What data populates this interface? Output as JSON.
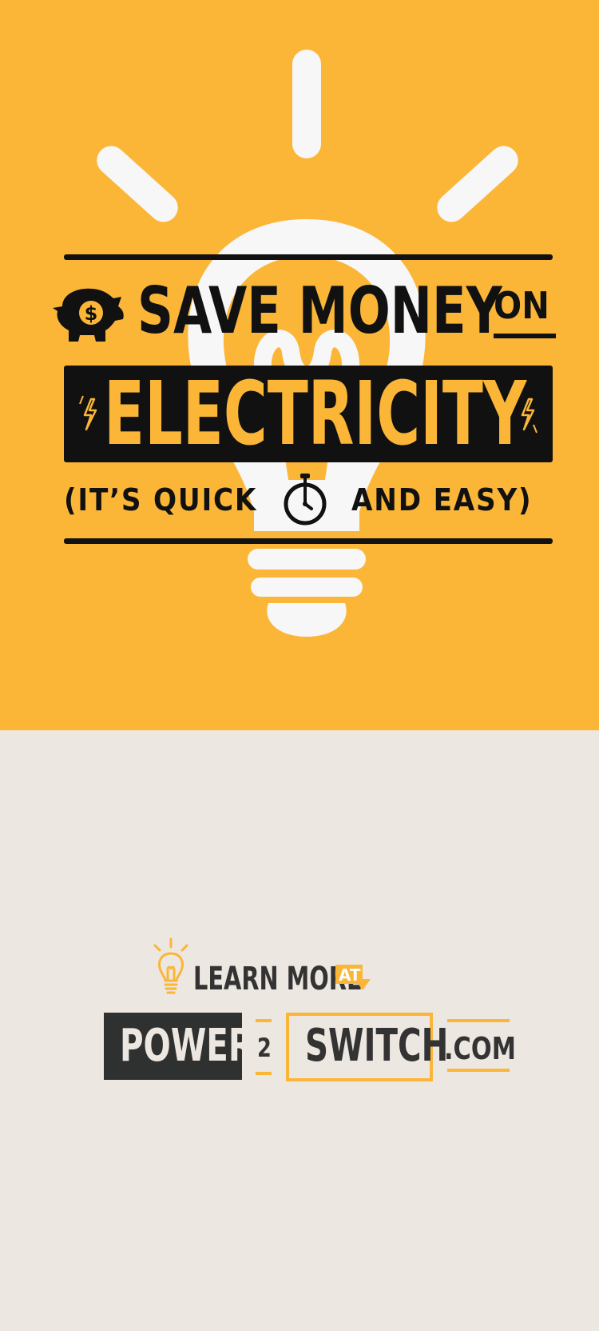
{
  "poster": {
    "headline": "SAVE MONEY",
    "headline_on": "ON",
    "electricity": "ELECTRICITY",
    "sub_left": "(IT’S QUICK",
    "sub_right": "AND  EASY)",
    "piggy_symbol": "$",
    "icons": [
      "lightbulb-icon",
      "piggy-bank-icon",
      "lightning-bolt-icon",
      "stopwatch-icon"
    ]
  },
  "footer": {
    "learn_more": "LEARN MORE",
    "at_label": "AT",
    "logo_power": "POWER",
    "logo_two": "2",
    "logo_switch": "SWITCH",
    "logo_com": ".COM"
  },
  "colors": {
    "accent_yellow": "#fbb638",
    "ink_black": "#111111",
    "bulb_white": "#f6f7f6",
    "footer_bg": "#ece7e1",
    "logo_dark": "#2f3030"
  }
}
